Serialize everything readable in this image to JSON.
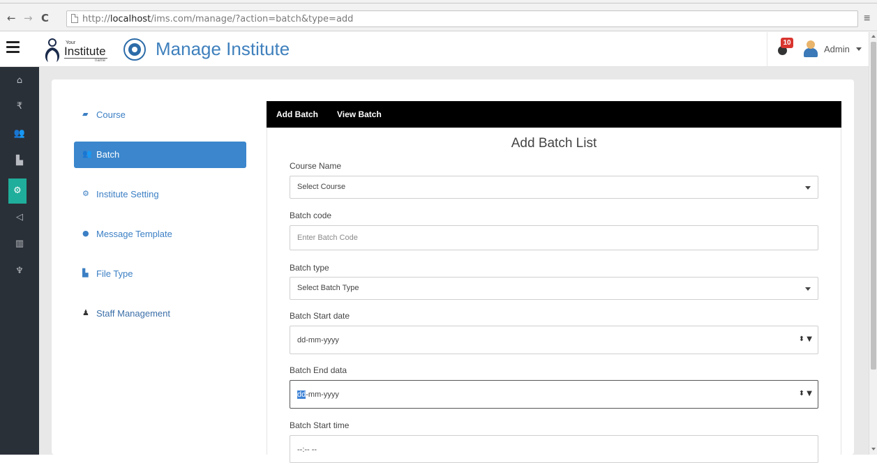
{
  "browser": {
    "back_icon": "back-arrow-icon",
    "forward_icon": "forward-arrow-icon",
    "reload_icon": "reload-icon",
    "url_prefix": "http://",
    "url_host": "localhost",
    "url_path": "/ims.com/manage/?action=batch&type=add"
  },
  "header": {
    "logo_your": "Your",
    "logo_institute": "Institute",
    "logo_name": "name",
    "title": "Manage Institute",
    "notification_count": "10",
    "user": "Admin"
  },
  "sidebar_icons": [
    "home-icon",
    "rupee-icon",
    "users-icon",
    "document-icon",
    "settings-icon",
    "megaphone-icon",
    "chart-icon",
    "trophy-icon"
  ],
  "menu": {
    "items": [
      {
        "label": "Course",
        "icon": "book-icon"
      },
      {
        "label": "Batch",
        "icon": "group-icon"
      },
      {
        "label": "Institute Setting",
        "icon": "cogs-icon"
      },
      {
        "label": "Message Template",
        "icon": "comment-icon"
      },
      {
        "label": "File Type",
        "icon": "file-icon"
      },
      {
        "label": "Staff Management",
        "icon": "user-icon"
      }
    ]
  },
  "tabs": {
    "add": "Add Batch",
    "view": "View Batch"
  },
  "form": {
    "title": "Add Batch List",
    "course_name_label": "Course Name",
    "course_name_value": "Select Course",
    "batch_code_label": "Batch code",
    "batch_code_placeholder": "Enter Batch Code",
    "batch_type_label": "Batch type",
    "batch_type_value": "Select Batch Type",
    "start_date_label": "Batch Start date",
    "start_date_value": "dd-mm-yyyy",
    "end_date_label": "Batch End data",
    "end_date_dd": "dd",
    "end_date_rest": "-mm-yyyy",
    "start_time_label": "Batch Start time",
    "start_time_value": "--:-- --",
    "date_spinner": "⬍ ▼"
  },
  "colors": {
    "accent": "#3b86cc",
    "sidebar_bg": "#2a3038",
    "sidebar_active": "#1fae9b",
    "title_blue": "#3f80bd",
    "badge_red": "#d9352f"
  }
}
